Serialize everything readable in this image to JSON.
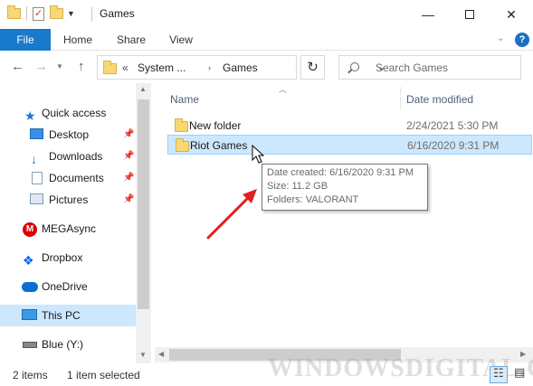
{
  "window": {
    "title": "Games",
    "minimize_glyph": "—",
    "close_glyph": "✕"
  },
  "ribbon": {
    "tabs": [
      {
        "label": "File"
      },
      {
        "label": "Home"
      },
      {
        "label": "Share"
      },
      {
        "label": "View"
      }
    ],
    "help_glyph": "?"
  },
  "address": {
    "overflow": "«",
    "crumbs": [
      "System ...",
      "Games"
    ],
    "crumb_separator": "›",
    "search_placeholder": "Search Games"
  },
  "nav_pane": {
    "items": [
      {
        "label": "Quick access",
        "icon": "star-icon"
      },
      {
        "label": "Desktop",
        "icon": "desktop-icon",
        "pinned": true
      },
      {
        "label": "Downloads",
        "icon": "download-icon",
        "pinned": true
      },
      {
        "label": "Documents",
        "icon": "document-icon",
        "pinned": true
      },
      {
        "label": "Pictures",
        "icon": "pictures-icon",
        "pinned": true
      },
      {
        "label": "MEGAsync",
        "icon": "mega-icon"
      },
      {
        "label": "Dropbox",
        "icon": "dropbox-icon"
      },
      {
        "label": "OneDrive",
        "icon": "onedrive-icon"
      },
      {
        "label": "This PC",
        "icon": "pc-icon",
        "selected": true
      },
      {
        "label": "Blue (Y:)",
        "icon": "drive-icon"
      }
    ]
  },
  "file_list": {
    "columns": [
      "Name",
      "Date modified"
    ],
    "rows": [
      {
        "name": "New folder",
        "date_modified": "2/24/2021 5:30 PM"
      },
      {
        "name": "Riot Games",
        "date_modified": "6/16/2020 9:31 PM",
        "hovered": true
      }
    ]
  },
  "tooltip": {
    "date_created": "Date created: 6/16/2020 9:31 PM",
    "size": "Size: 11.2 GB",
    "folders": "Folders: VALORANT"
  },
  "status": {
    "item_count": "2 items",
    "selection": "1 item selected"
  },
  "watermark": "WINDOWSDIGITAL.COM",
  "colors": {
    "accent": "#1979ca",
    "selection": "#cce8ff",
    "annotation_arrow": "#e02020"
  }
}
